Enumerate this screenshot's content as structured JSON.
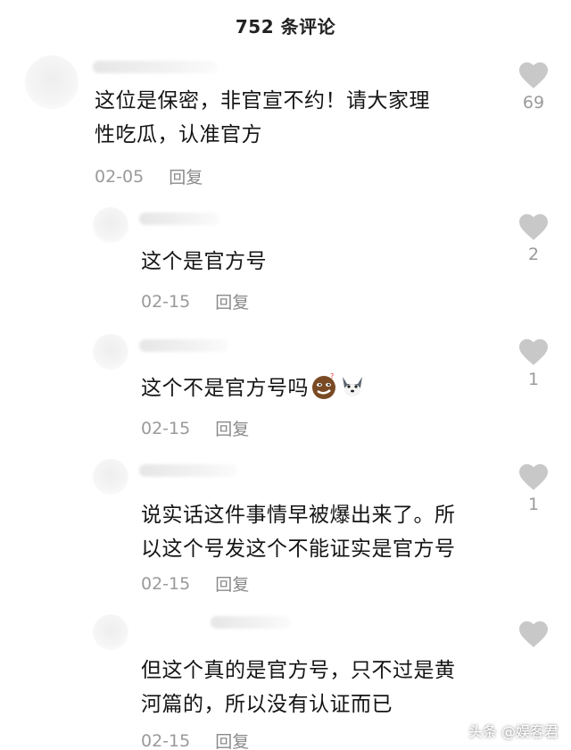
{
  "header": {
    "title": "752 条评论"
  },
  "comments": [
    {
      "text_line1": "这位是保密，非官宣不约！请大家理",
      "text_line2": "性吃瓜，认准官方",
      "date": "02-05",
      "reply": "回复",
      "likes": "69"
    },
    {
      "text_line1": "这个是官方号",
      "date": "02-15",
      "reply": "回复",
      "likes": "2"
    },
    {
      "text_line1": "这个不是官方号吗",
      "emojis": [
        "smirk-emoji",
        "husky-emoji"
      ],
      "date": "02-15",
      "reply": "回复",
      "likes": "1"
    },
    {
      "text_line1": "说实话这件事情早被爆出来了。所",
      "text_line2": "以这个号发这个不能证实是官方号",
      "date": "02-15",
      "reply": "回复",
      "likes": "1"
    },
    {
      "text_line1": "但这个真的是官方号，只不过是黄",
      "text_line2": "河篇的，所以没有认证而已",
      "date": "02-15",
      "reply": "回复",
      "likes": ""
    }
  ],
  "watermark": "头条 @娱客君",
  "colors": {
    "heart": "#c8c8c8",
    "meta": "#9a9a9a",
    "text": "#151515"
  }
}
